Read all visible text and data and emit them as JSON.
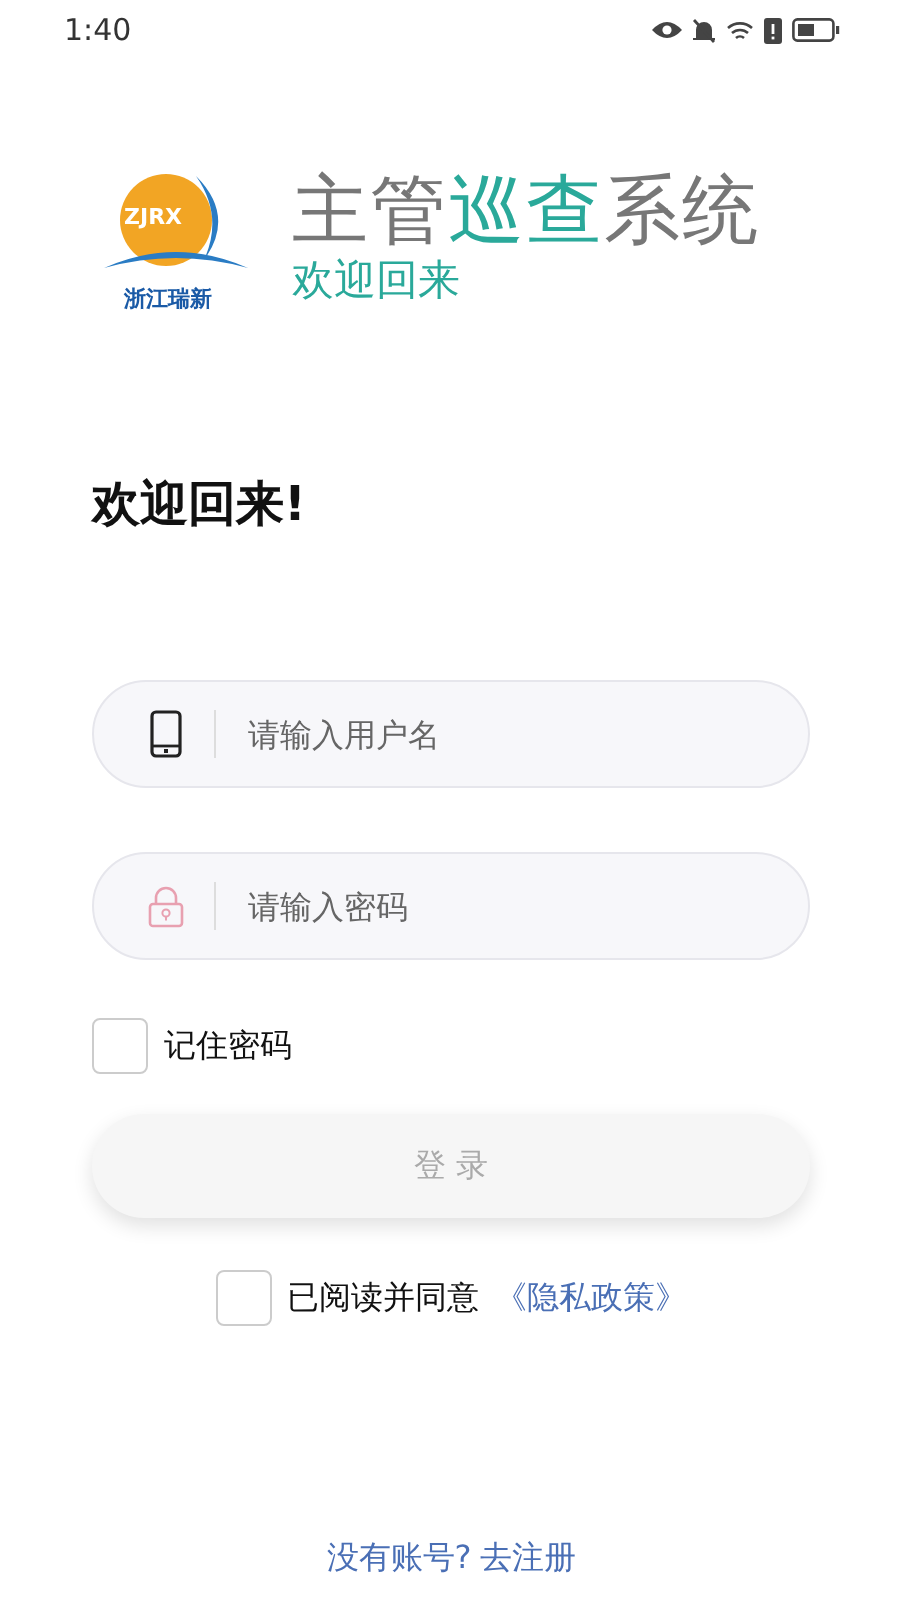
{
  "status_bar": {
    "time": "1:40"
  },
  "logo": {
    "emblem_text": "ZJRX",
    "company": "浙江瑞新",
    "title_parts": [
      {
        "text": "主管",
        "accent": false
      },
      {
        "text": "巡查",
        "accent": true
      },
      {
        "text": "系统",
        "accent": false
      }
    ],
    "subtitle": "欢迎回来"
  },
  "heading": "欢迎回来!",
  "fields": [
    {
      "kind": "phone",
      "placeholder": "请输入用户名"
    },
    {
      "kind": "lock",
      "placeholder": "请输入密码"
    }
  ],
  "remember": {
    "label": "记住密码",
    "checked": false
  },
  "login_button": {
    "label": "登 录",
    "disabled": true
  },
  "agreement": {
    "checked": false,
    "text": "已阅读并同意",
    "link": "《隐私政策》"
  },
  "register": {
    "text": "没有账号?",
    "link": "去注册"
  }
}
